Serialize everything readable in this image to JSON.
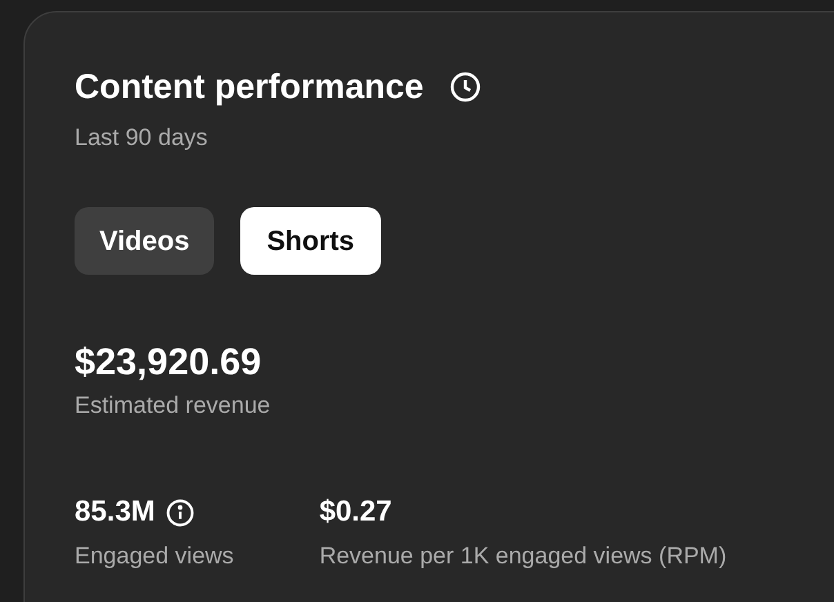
{
  "card": {
    "title": "Content performance",
    "subtitle": "Last 90 days"
  },
  "tabs": [
    {
      "label": "Videos",
      "selected": false
    },
    {
      "label": "Shorts",
      "selected": true
    }
  ],
  "headline": {
    "value": "$23,920.69",
    "label": "Estimated revenue"
  },
  "metrics": [
    {
      "value": "85.3M",
      "label": "Engaged views",
      "info": true
    },
    {
      "value": "$0.27",
      "label": "Revenue per 1K engaged views (RPM)",
      "info": false
    }
  ]
}
